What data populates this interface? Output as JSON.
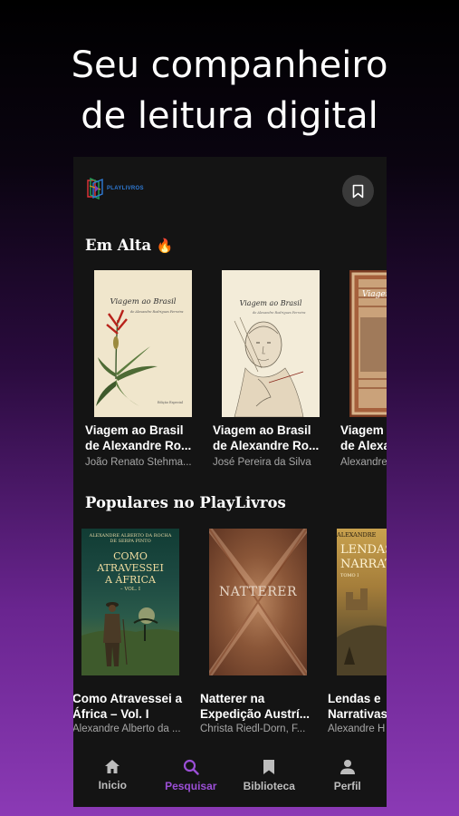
{
  "headline": {
    "line1": "Seu companheiro",
    "line2": "de leitura digital"
  },
  "app": {
    "logo_text": "PLAYLIVROS",
    "sections": {
      "trending": {
        "title": "Em Alta",
        "emoji": "🔥"
      },
      "popular": {
        "title": "Populares no PlayLivros"
      }
    },
    "trending_books": [
      {
        "title_line1": "Viagem ao Brasil",
        "title_line2": "de Alexandre Ro...",
        "author": "João Renato Stehma...",
        "cover_title": "Viagem ao Brasil",
        "cover_sub": "de Alexandre Rodrigues Ferreira",
        "cover_footer": "Edição Especial"
      },
      {
        "title_line1": "Viagem ao Brasil",
        "title_line2": "de Alexandre Ro...",
        "author": "José Pereira da Silva",
        "cover_title": "Viagem ao Brasil",
        "cover_sub": "de Alexandre Rodrigues Ferreira"
      },
      {
        "title_line1": "Viagem ao Brasil",
        "title_line2": "de Alexandre Ro...",
        "author": "Alexandre Rodrigues",
        "cover_title": "Viagem"
      }
    ],
    "popular_books": [
      {
        "title_line1": "Como Atravessei a",
        "title_line2": "África – Vol. I",
        "author": "Alexandre Alberto da ...",
        "cover_author": "ALEXANDRE ALBERTO DA ROCHA DE SERPA PINTO",
        "cover_title_1": "COMO",
        "cover_title_2": "ATRAVESSEI",
        "cover_title_3": "A ÁFRICA",
        "cover_vol": "– VOL. I"
      },
      {
        "title_line1": "Natterer na",
        "title_line2": "Expedição Austrí...",
        "author": "Christa Riedl-Dorn, F...",
        "cover_title": "NATTERER"
      },
      {
        "title_line1": "Lendas e",
        "title_line2": "Narrativas",
        "author": "Alexandre H",
        "cover_author": "ALEXANDRE",
        "cover_title_1": "LENDAS",
        "cover_title_2": "NARRATIVAS",
        "cover_vol": "TOMO I"
      }
    ],
    "nav": [
      {
        "label": "Inicio",
        "icon": "home-icon"
      },
      {
        "label": "Pesquisar",
        "icon": "search-icon",
        "active": true
      },
      {
        "label": "Biblioteca",
        "icon": "bookmark-icon"
      },
      {
        "label": "Perfil",
        "icon": "user-icon"
      }
    ],
    "colors": {
      "accent": "#9b4fd6",
      "background": "#141414",
      "logo_blue": "#2f7bd6"
    }
  }
}
